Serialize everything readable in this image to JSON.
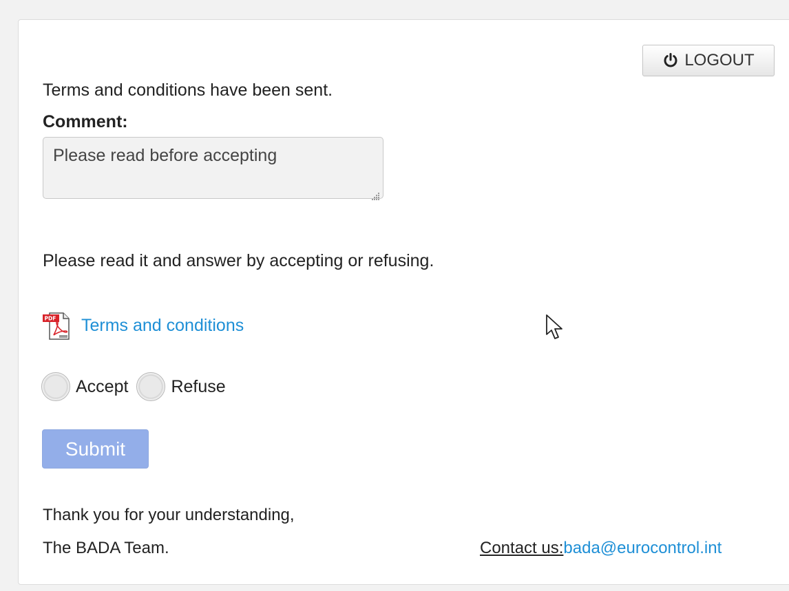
{
  "header": {
    "logout_label": "LOGOUT",
    "logout_icon": "power-icon"
  },
  "main": {
    "status_message": "Terms and conditions have been sent.",
    "comment_label": "Comment:",
    "comment_value": "Please read before accepting",
    "instruction": "Please read it and answer by accepting or refusing.",
    "document_link": {
      "icon": "pdf-icon",
      "label": "Terms and conditions"
    },
    "options": [
      {
        "label": "Accept",
        "selected": false
      },
      {
        "label": "Refuse",
        "selected": false
      }
    ],
    "submit_label": "Submit",
    "submit_enabled": false
  },
  "footer": {
    "thanks": "Thank you for your understanding,",
    "signature": "The BADA Team.",
    "contact_label": "Contact us:",
    "contact_email": "bada@eurocontrol.int"
  },
  "colors": {
    "link": "#1e8fd6",
    "submit_disabled": "#93aee9",
    "pdf_red": "#d8232a"
  }
}
